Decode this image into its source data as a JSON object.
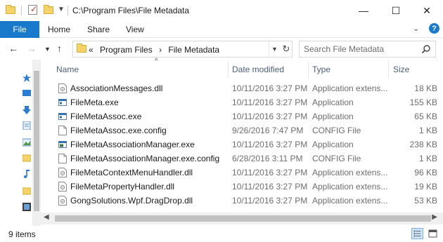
{
  "window": {
    "title": "C:\\Program Files\\File Metadata",
    "controls": {
      "minimize": "—",
      "maximize": "☐",
      "close": "✕"
    }
  },
  "ribbon": {
    "tabs": [
      {
        "label": "File",
        "active": true
      },
      {
        "label": "Home"
      },
      {
        "label": "Share"
      },
      {
        "label": "View"
      }
    ],
    "help": "?"
  },
  "address": {
    "prefix": "«",
    "crumbs": [
      "Program Files",
      "File Metadata"
    ],
    "separator": "›"
  },
  "search": {
    "placeholder": "Search File Metadata"
  },
  "columns": {
    "name": "Name",
    "date_modified": "Date modified",
    "type": "Type",
    "size": "Size"
  },
  "files": [
    {
      "name": "AssociationMessages.dll",
      "date": "10/11/2016 3:27 PM",
      "type": "Application extens...",
      "size": "18 KB",
      "icon": "dll-icon"
    },
    {
      "name": "FileMeta.exe",
      "date": "10/11/2016 3:27 PM",
      "type": "Application",
      "size": "155 KB",
      "icon": "exe-icon"
    },
    {
      "name": "FileMetaAssoc.exe",
      "date": "10/11/2016 3:27 PM",
      "type": "Application",
      "size": "65 KB",
      "icon": "exe-icon"
    },
    {
      "name": "FileMetaAssoc.exe.config",
      "date": "9/26/2016 7:47 PM",
      "type": "CONFIG File",
      "size": "1 KB",
      "icon": "config-file-icon"
    },
    {
      "name": "FileMetaAssociationManager.exe",
      "date": "10/11/2016 3:27 PM",
      "type": "Application",
      "size": "238 KB",
      "icon": "app-exe-icon"
    },
    {
      "name": "FileMetaAssociationManager.exe.config",
      "date": "6/28/2016 3:11 PM",
      "type": "CONFIG File",
      "size": "1 KB",
      "icon": "config-file-icon"
    },
    {
      "name": "FileMetaContextMenuHandler.dll",
      "date": "10/11/2016 3:27 PM",
      "type": "Application extens...",
      "size": "96 KB",
      "icon": "dll-icon"
    },
    {
      "name": "FileMetaPropertyHandler.dll",
      "date": "10/11/2016 3:27 PM",
      "type": "Application extens...",
      "size": "19 KB",
      "icon": "dll-icon"
    },
    {
      "name": "GongSolutions.Wpf.DragDrop.dll",
      "date": "10/11/2016 3:27 PM",
      "type": "Application extens...",
      "size": "53 KB",
      "icon": "dll-icon"
    }
  ],
  "status": {
    "item_count": "9 items"
  },
  "colors": {
    "accent": "#1979ca",
    "folder": "#f4d46a",
    "header_text": "#4c607a"
  }
}
